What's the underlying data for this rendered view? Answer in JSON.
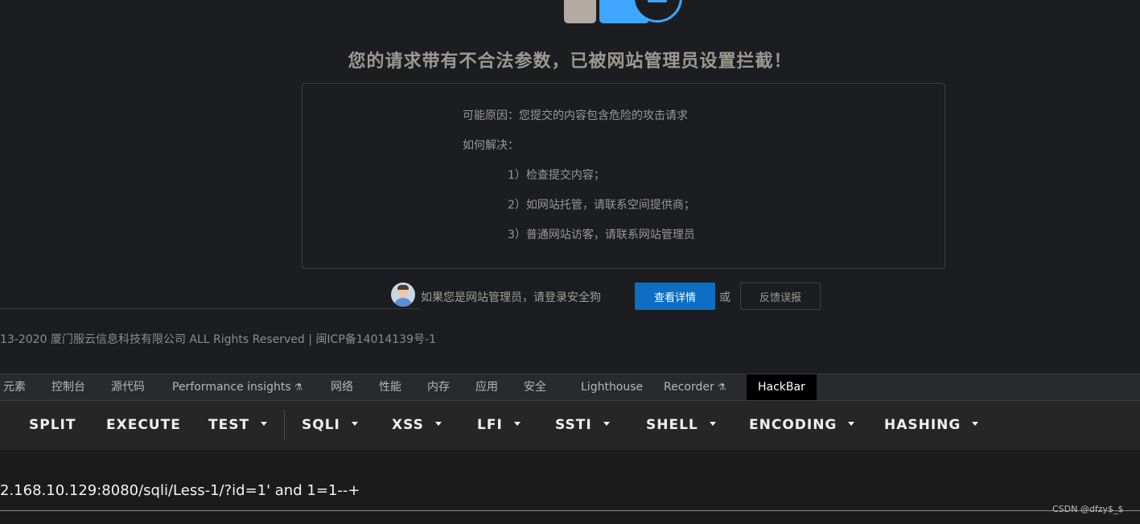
{
  "blocked_page": {
    "title": "您的请求带有不合法参数，已被网站管理员设置拦截！",
    "reason_line": "可能原因：您提交的内容包含危险的攻击请求",
    "solution_label": "如何解决：",
    "solution_1": "1）检查提交内容；",
    "solution_2": "2）如网站托管，请联系空间提供商；",
    "solution_3": "3）普通网站访客，请联系网站管理员",
    "admin_prompt": "如果您是网站管理员，请登录安全狗",
    "detail_button": "查看详情",
    "or_text": "或",
    "feedback_button": "反馈误报",
    "footer_copyright": "13-2020 厦门服云信息科技有限公司 ALL Rights Reserved | 闽ICP备14014139号-1",
    "colors": {
      "accent_blue": "#0d6ec4",
      "illustration_blue": "#3ea6ff",
      "title_color": "#9d9890"
    }
  },
  "devtools": {
    "tabs": {
      "elements": "元素",
      "console": "控制台",
      "sources": "源代码",
      "performance_insights": "Performance insights",
      "network": "网络",
      "performance": "性能",
      "memory": "内存",
      "application": "应用",
      "security": "安全",
      "lighthouse": "Lighthouse",
      "recorder": "Recorder",
      "hackbar": "HackBar"
    },
    "active_tab": "HackBar",
    "experimental_icon": "flask-icon"
  },
  "hackbar": {
    "buttons": {
      "split": "SPLIT",
      "execute": "EXECUTE",
      "test": "TEST",
      "sqli": "SQLI",
      "xss": "XSS",
      "lfi": "LFI",
      "ssti": "SSTI",
      "shell": "SHELL",
      "encoding": "ENCODING",
      "hashing": "HASHING"
    },
    "url_value": "2.168.10.129:8080/sqli/Less-1/?id=1' and 1=1--+"
  },
  "watermark": "CSDN @dfzy$_$"
}
